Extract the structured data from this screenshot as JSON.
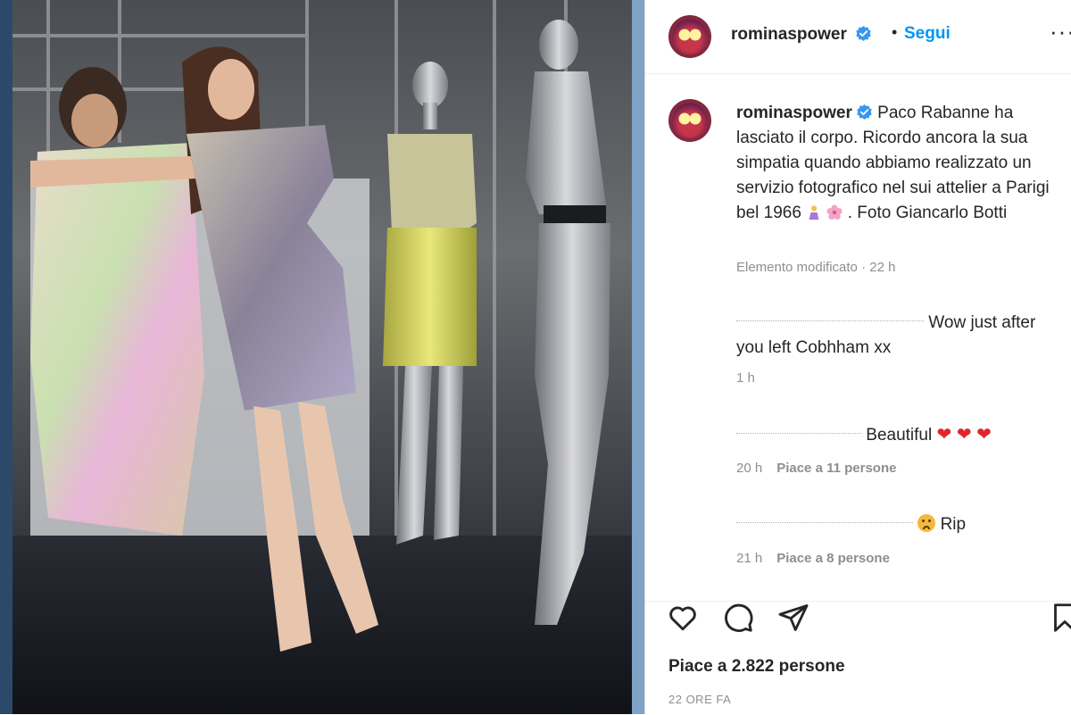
{
  "post": {
    "username": "rominaspower",
    "follow_label": "Segui",
    "more_label": "···",
    "dot": "•"
  },
  "caption": {
    "username": "rominaspower",
    "text_part1": " Paco Rabanne ha lasciato il corpo. Ricordo ancora la sua simpatia quando abbiamo realizzato un servizio fotografico nel sui attelier a Parigi bel 1966 ",
    "text_part2": " . Foto Giancarlo Botti",
    "meta": "Elemento modificato · 22 h"
  },
  "comments": [
    {
      "text": "Wow just after you left Cobhham xx",
      "time": "1 h",
      "likes": ""
    },
    {
      "text": "Beautiful ",
      "hearts": "❤ ❤ ❤",
      "time": "20 h",
      "likes": "Piace a 11 persone"
    },
    {
      "text": "Rip",
      "time": "21 h",
      "likes": "Piace a 8 persone"
    }
  ],
  "footer": {
    "likes": "Piace a 2.822 persone",
    "time_ago": "22 ORE FA"
  },
  "icons": [
    "heart-icon",
    "comment-icon",
    "share-icon",
    "bookmark-icon",
    "verified-icon"
  ],
  "colors": {
    "accent": "#0095f6",
    "verified": "#3897f0",
    "text": "#262626",
    "muted": "#8e8e8e"
  }
}
